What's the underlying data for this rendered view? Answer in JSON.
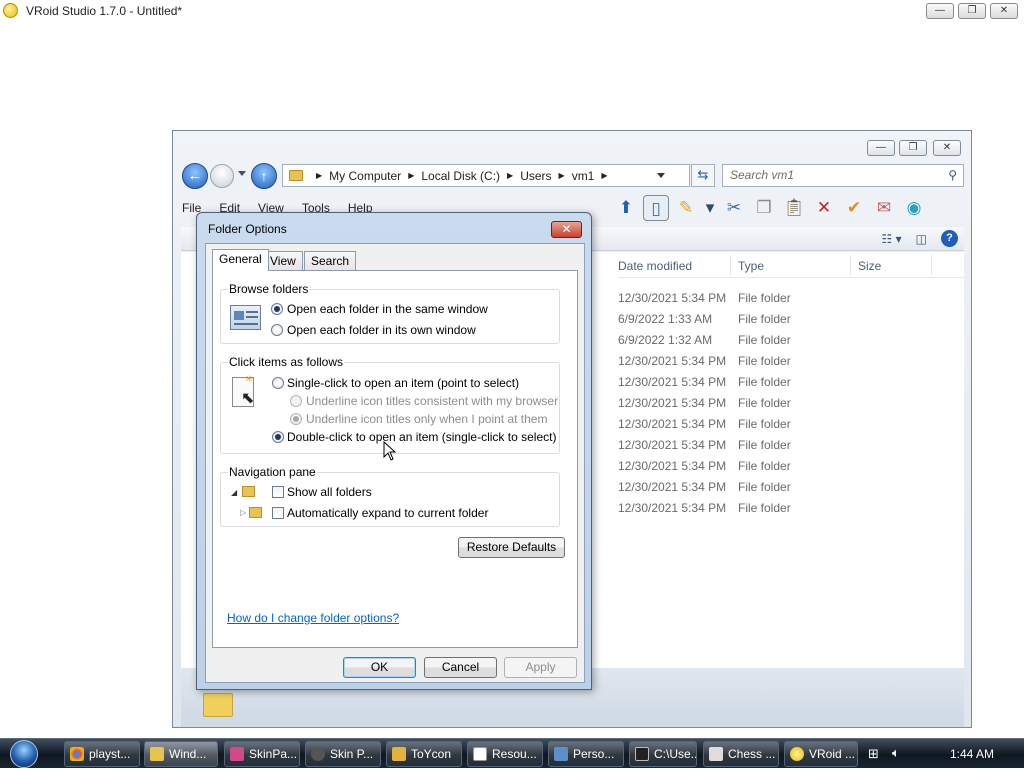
{
  "app_window": {
    "title": "VRoid Studio 1.7.0 - Untitled*",
    "minimize_glyph": "—",
    "maximize_glyph": "❐",
    "close_glyph": "✕"
  },
  "explorer": {
    "breadcrumb": [
      "My Computer",
      "Local Disk (C:)",
      "Users",
      "vm1"
    ],
    "search_placeholder": "Search vm1",
    "menu": [
      "File",
      "Edit",
      "View",
      "Tools",
      "Help"
    ],
    "columns": {
      "date": "Date modified",
      "type": "Type",
      "size": "Size"
    },
    "rows": [
      {
        "date": "12/30/2021 5:34 PM",
        "type": "File folder"
      },
      {
        "date": "6/9/2022 1:33 AM",
        "type": "File folder"
      },
      {
        "date": "6/9/2022 1:32 AM",
        "type": "File folder"
      },
      {
        "date": "12/30/2021 5:34 PM",
        "type": "File folder"
      },
      {
        "date": "12/30/2021 5:34 PM",
        "type": "File folder"
      },
      {
        "date": "12/30/2021 5:34 PM",
        "type": "File folder"
      },
      {
        "date": "12/30/2021 5:34 PM",
        "type": "File folder"
      },
      {
        "date": "12/30/2021 5:34 PM",
        "type": "File folder"
      },
      {
        "date": "12/30/2021 5:34 PM",
        "type": "File folder"
      },
      {
        "date": "12/30/2021 5:34 PM",
        "type": "File folder"
      },
      {
        "date": "12/30/2021 5:34 PM",
        "type": "File folder"
      }
    ]
  },
  "folder_options": {
    "title": "Folder Options",
    "tabs": [
      "General",
      "View",
      "Search"
    ],
    "browse_folders": {
      "label": "Browse folders",
      "same_window": "Open each folder in the same window",
      "own_window": "Open each folder in its own window",
      "selected": "same_window"
    },
    "click_items": {
      "label": "Click items as follows",
      "single_click": "Single-click to open an item (point to select)",
      "underline_browser": "Underline icon titles consistent with my browser",
      "underline_point": "Underline icon titles only when I point at them",
      "double_click": "Double-click to open an item (single-click to select)",
      "selected": "double_click"
    },
    "navigation_pane": {
      "label": "Navigation pane",
      "show_all_folders": "Show all folders",
      "auto_expand": "Automatically expand to current folder",
      "show_all_checked": false,
      "auto_expand_checked": false
    },
    "restore_defaults": "Restore Defaults",
    "help_link": "How do I change folder options?",
    "buttons": {
      "ok": "OK",
      "cancel": "Cancel",
      "apply": "Apply"
    }
  },
  "taskbar": {
    "items": [
      "playst...",
      "Wind...",
      "SkinPa...",
      "Skin P...",
      "ToYcon",
      "Resou...",
      "Perso...",
      "C:\\Use...",
      "Chess ...",
      "VRoid ..."
    ],
    "clock": "1:44 AM"
  }
}
